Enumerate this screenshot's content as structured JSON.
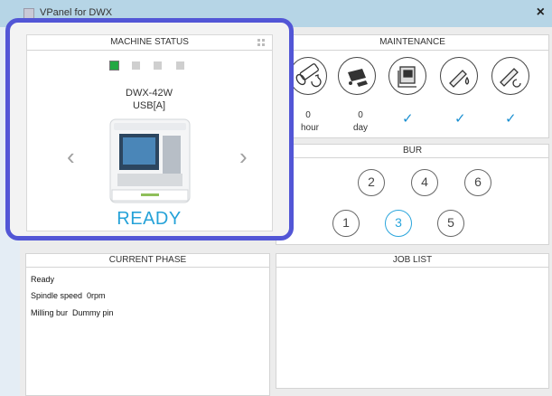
{
  "window": {
    "title": "VPanel for DWX",
    "close": "×"
  },
  "status_panel": {
    "title": "MACHINE STATUS",
    "machine_name": "DWX-42W",
    "port": "USB[A]",
    "state": "READY",
    "prev_arrow": "‹",
    "next_arrow": "›",
    "page_dots": [
      true,
      false,
      false,
      false
    ],
    "accent": "#25a2d8",
    "highlight": "#5256d6"
  },
  "maintenance": {
    "title": "MAINTENANCE",
    "items": [
      {
        "icon": "spindle-icon",
        "value": "0",
        "unit": "hour"
      },
      {
        "icon": "clean-icon",
        "value": "0",
        "unit": "day"
      },
      {
        "icon": "manual-icon",
        "value": "✓"
      },
      {
        "icon": "oil-icon",
        "value": "✓"
      },
      {
        "icon": "collet-icon",
        "value": "✓"
      }
    ]
  },
  "bur": {
    "title": "BUR",
    "row1": [
      "2",
      "4",
      "6"
    ],
    "row2": [
      "1",
      "3",
      "5"
    ],
    "selected": "3"
  },
  "current_phase": {
    "title": "CURRENT PHASE",
    "lines": [
      "Ready",
      "Spindle speed  0rpm",
      "Milling bur  Dummy pin"
    ]
  },
  "job_list": {
    "title": "JOB LIST"
  }
}
